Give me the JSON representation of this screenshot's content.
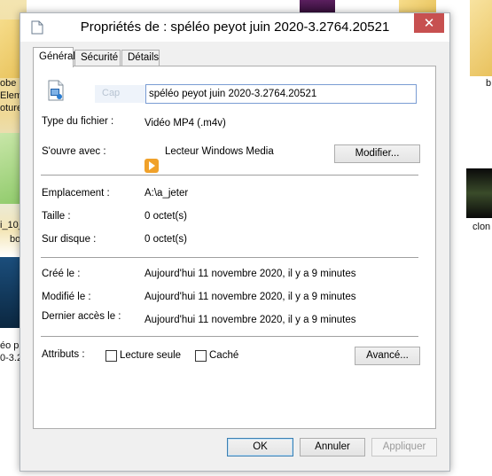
{
  "desktop": {
    "left_texts": [
      "obe I",
      "Elem",
      "oture",
      "i_10_",
      "bo",
      "éo p",
      "0-3.2"
    ],
    "right_texts": [
      "b",
      "clon"
    ]
  },
  "window": {
    "title": "Propriétés de : spéléo peyot juin 2020-3.2764.20521",
    "close_glyph": "✕"
  },
  "tabs": [
    {
      "label": "Général",
      "active": true
    },
    {
      "label": "Sécurité",
      "active": false
    },
    {
      "label": "Détails",
      "active": false
    }
  ],
  "general": {
    "filename": "spéléo peyot juin 2020-3.2764.20521",
    "ghost_text": "Cap",
    "file_type_label": "Type du fichier :",
    "file_type_value": "Vidéo MP4 (.m4v)",
    "opens_with_label": "S'ouvre avec :",
    "opens_with_value": "Lecteur Windows Media",
    "change_button": "Modifier...",
    "location_label": "Emplacement :",
    "location_value": "A:\\a_jeter",
    "size_label": "Taille :",
    "size_value": "0 octet(s)",
    "ondisk_label": "Sur disque :",
    "ondisk_value": "0 octet(s)",
    "created_label": "Créé le :",
    "created_value": "Aujourd'hui 11 novembre 2020, il y a 9 minutes",
    "modified_label": "Modifié le :",
    "modified_value": "Aujourd'hui 11 novembre 2020, il y a 9 minutes",
    "accessed_label": "Dernier accès le :",
    "accessed_value": "Aujourd'hui 11 novembre 2020, il y a 9 minutes",
    "attributes_label": "Attributs :",
    "readonly_label": "Lecture seule",
    "readonly_checked": false,
    "hidden_label": "Caché",
    "hidden_checked": false,
    "advanced_button": "Avancé..."
  },
  "footer": {
    "ok": "OK",
    "cancel": "Annuler",
    "apply": "Appliquer"
  },
  "colors": {
    "close_button": "#c75050",
    "input_border": "#7a9cd3",
    "ok_border": "#3c7fb1"
  }
}
